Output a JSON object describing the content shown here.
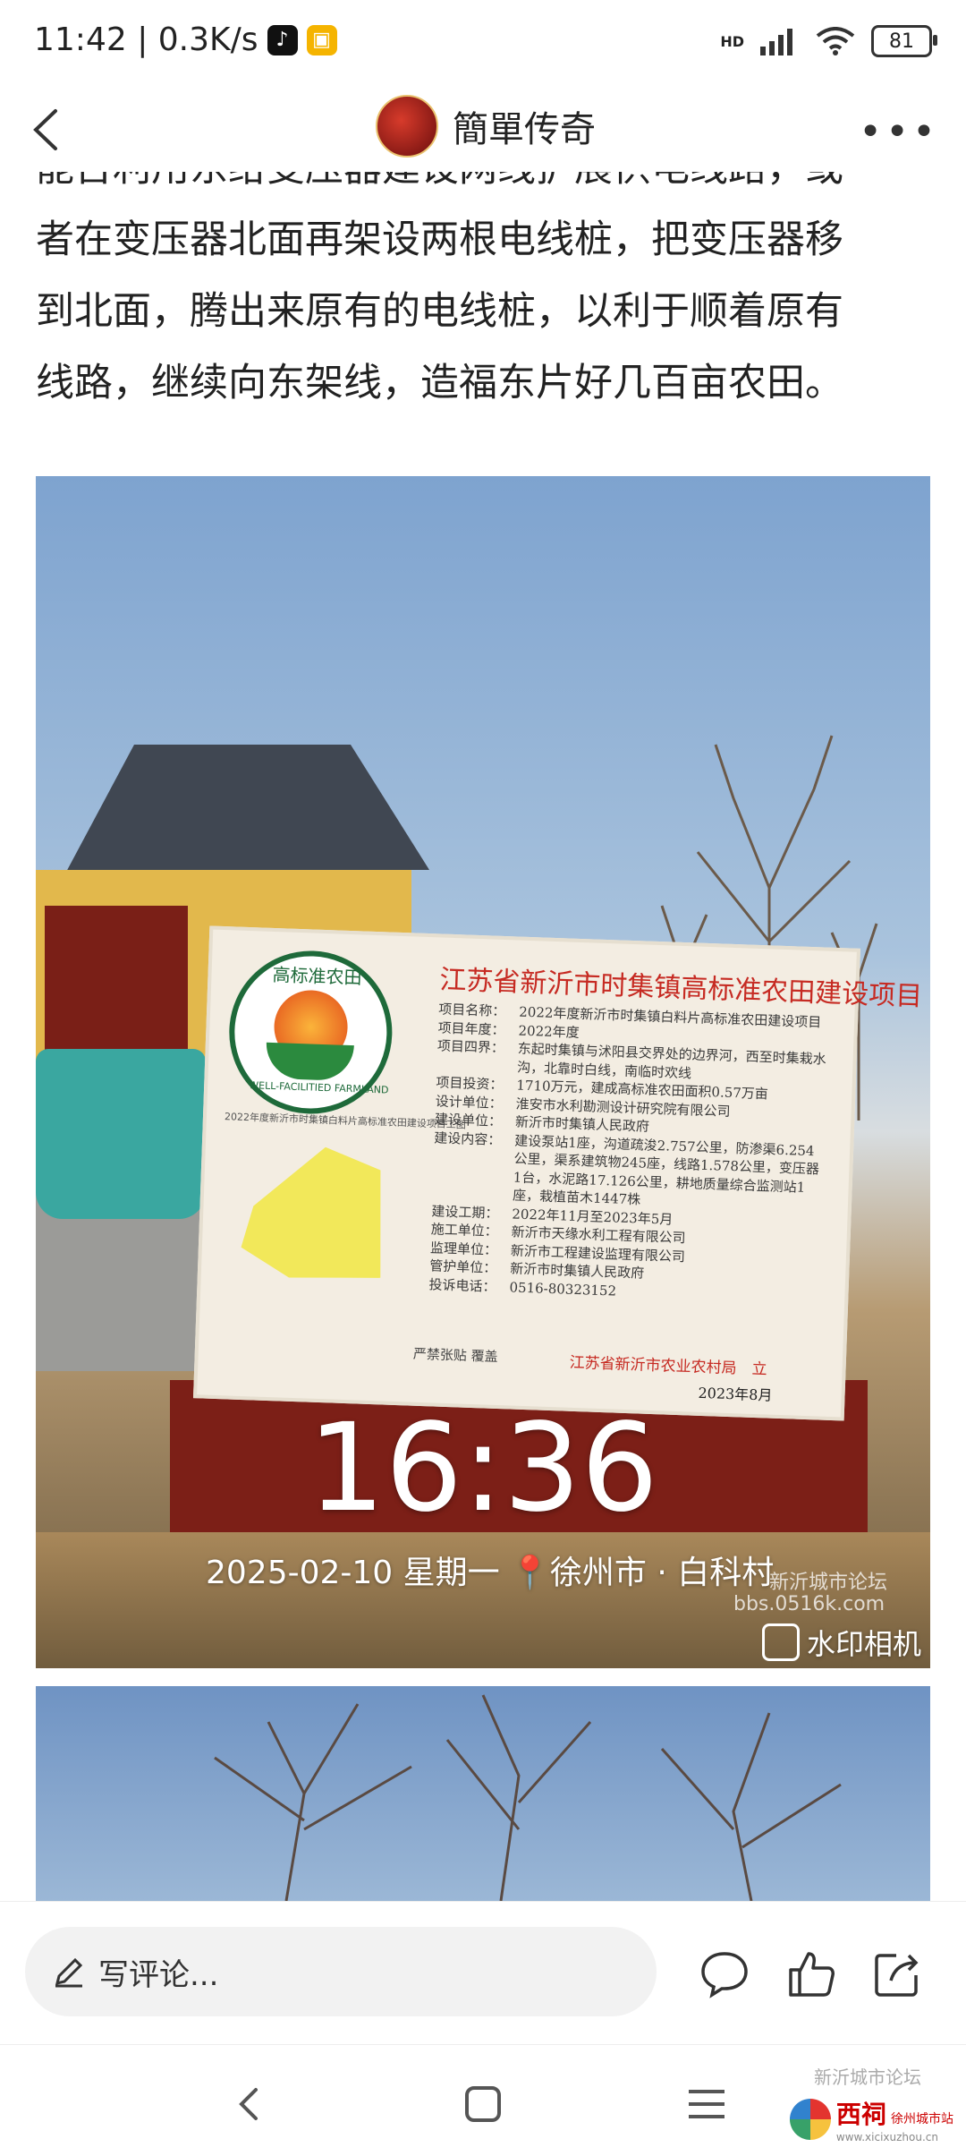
{
  "status_bar": {
    "time_speed": "11:42 | 0.3K/s",
    "network": "HD",
    "battery": "81"
  },
  "header": {
    "title": "簡單传奇"
  },
  "article": {
    "partial_line": "能否利用东给变压器建设网线扩展供电线路，或",
    "lines": [
      "者在变压器北面再架设两根电线桩，把变压器移",
      "到北面，腾出来原有的电线桩，以利于顺着原有",
      "线路，继续向东架线，造福东片好几百亩农田。"
    ]
  },
  "photo1": {
    "board": {
      "title": "江苏省新沂市时集镇高标准农田建设项目",
      "logo_top": "高标准农田",
      "logo_bottom": "WELL-FACILITIED FARMLAND",
      "map_caption": "2022年度新沂市时集镇白料片高标准农田建设项目工图",
      "rows": [
        {
          "k": "项目名称：",
          "v": "2022年度新沂市时集镇白料片高标准农田建设项目"
        },
        {
          "k": "项目年度：",
          "v": "2022年度"
        },
        {
          "k": "项目四界：",
          "v": "东起时集镇与沭阳县交界处的边界河，西至时集栽水沟，北靠时白线，南临时欢线"
        },
        {
          "k": "项目投资：",
          "v": "1710万元，建成高标准农田面积0.57万亩"
        },
        {
          "k": "设计单位：",
          "v": "淮安市水利勘测设计研究院有限公司"
        },
        {
          "k": "建设单位：",
          "v": "新沂市时集镇人民政府"
        },
        {
          "k": "建设内容：",
          "v": "建设泵站1座，沟道疏浚2.757公里，防渗渠6.254公里，渠系建筑物245座，线路1.578公里，变压器1台，水泥路17.126公里，耕地质量综合监测站1座，栽植苗木1447株"
        },
        {
          "k": "建设工期：",
          "v": "2022年11月至2023年5月"
        },
        {
          "k": "施工单位：",
          "v": "新沂市天缘水利工程有限公司"
        },
        {
          "k": "监理单位：",
          "v": "新沂市工程建设监理有限公司"
        },
        {
          "k": "管护单位：",
          "v": "新沂市时集镇人民政府"
        },
        {
          "k": "投诉电话：",
          "v": "0516-80323152"
        }
      ],
      "footer_left": "严禁张贴 覆盖",
      "footer_org": "江苏省新沂市农业农村局　立",
      "footer_date": "2023年8月"
    },
    "watermark": {
      "time": "16:36",
      "date_location": "2025-02-10 星期一 📍徐州市 · 白科村",
      "forum": "新沂城市论坛",
      "url": "bbs.0516k.com",
      "camera": "水印相机"
    }
  },
  "comment_bar": {
    "placeholder": "写评论..."
  },
  "navbar": {
    "wm_forum": "新沂城市论坛",
    "wm_brand": "西祠",
    "wm_brand_sub": "徐州城市站",
    "wm_url": "www.xicixuzhou.cn"
  },
  "icons": [
    "back-icon",
    "more-icon",
    "pencil-icon",
    "comment-icon",
    "like-icon",
    "share-icon",
    "nav-back-icon",
    "nav-home-icon",
    "nav-menu-icon",
    "camera-icon",
    "location-pin-icon"
  ]
}
